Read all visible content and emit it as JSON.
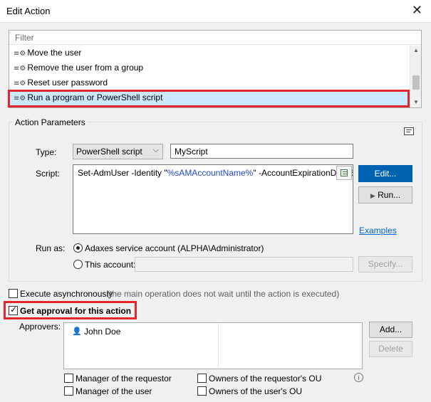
{
  "window": {
    "title": "Edit Action",
    "close_glyph": "✕"
  },
  "filter_placeholder": "Filter",
  "action_items": [
    {
      "label": "Move the user",
      "selected": false
    },
    {
      "label": "Remove the user from a group",
      "selected": false
    },
    {
      "label": "Reset user password",
      "selected": false
    },
    {
      "label": "Run a program or PowerShell script",
      "selected": true
    }
  ],
  "action_parameters": {
    "group_label": "Action Parameters",
    "type_label": "Type:",
    "type_value": "PowerShell script",
    "name_value": "MyScript",
    "script_label": "Script:",
    "script_prefix": "Set-AdmUser -Identity \"",
    "script_variable": "%sAMAccountName%",
    "script_suffix": "\" -AccountExpirationDate $T",
    "edit_button": "Edit...",
    "run_button": "Run...",
    "examples_link": "Examples",
    "run_as_label": "Run as:",
    "service_account_option": "Adaxes service account (ALPHA\\Administrator)",
    "this_account_option": "This account:",
    "this_account_value": "",
    "specify_button": "Specify..."
  },
  "execute_async": {
    "label": "Execute asynchronously",
    "note": "(the main operation does not wait until the action is executed)",
    "checked": false
  },
  "approval": {
    "label": "Get approval for this action",
    "checked": true,
    "approvers_label": "Approvers:",
    "approvers": [
      "John Doe"
    ],
    "add_button": "Add...",
    "delete_button": "Delete",
    "options": [
      {
        "label": "Manager of the requestor",
        "checked": false
      },
      {
        "label": "Owners of the requestor's OU",
        "checked": false
      },
      {
        "label": "Manager of the user",
        "checked": false
      },
      {
        "label": "Owners of the user's OU",
        "checked": false
      }
    ]
  },
  "icons": {
    "action_item": "gear-icon",
    "parameters_corner": "display-mode-icon",
    "insert_variable": "insert-variable-icon",
    "run": "play-icon",
    "user": "user-icon",
    "info": "info-icon"
  },
  "colors": {
    "highlight_frame": "#e2262e",
    "selection": "#cce8ff",
    "primary_button": "#0063b1",
    "variable_text": "#1f47d6",
    "link": "#0066cc"
  }
}
